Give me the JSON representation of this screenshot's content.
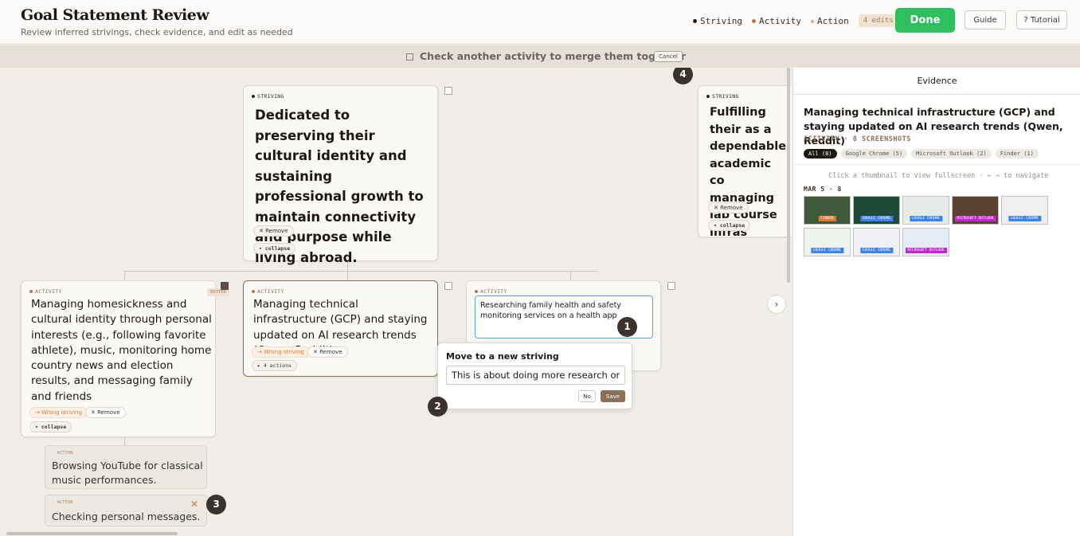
{
  "header": {
    "title": "Goal Statement Review",
    "subtitle": "Review inferred strivings, check evidence, and edit as needed",
    "legend": {
      "striving": "Striving",
      "activity": "Activity",
      "action": "Action"
    },
    "edits_badge": "4 edits",
    "done_label": "Done",
    "guide_label": "Guide",
    "tutorial_label": "? Tutorial"
  },
  "merge_banner": {
    "text": "Check another activity to merge them together",
    "cancel_label": "Cancel"
  },
  "strivings": [
    {
      "tag": "STRIVING",
      "text": "Dedicated to preserving their cultural identity and sustaining professional growth to maintain connectivity and purpose while living abroad.",
      "remove_label": "✕ Remove",
      "collapse_label": "▾ collapse"
    },
    {
      "tag": "STRIVING",
      "text": "Fulfilling their as a dependable academic co managing lab course infras",
      "remove_label": "✕ Remove",
      "collapse_label": "▾ collapse"
    }
  ],
  "activities": [
    {
      "tag": "ACTIVITY",
      "badge": "EDITED",
      "text": "Managing homesickness and cultural identity through personal interests (e.g., following favorite athlete), music, monitoring home country news and election results, and messaging family and friends",
      "wrong_label": "→ Wrong striving",
      "remove_label": "✕ Remove",
      "collapse_label": "▾ collapse"
    },
    {
      "tag": "ACTIVITY",
      "text": "Managing technical infrastructure (GCP) and staying updated on AI research trends (Qwen, Reddit)",
      "wrong_label": "→ Wrong striving",
      "remove_label": "✕ Remove",
      "actions_label": "▸ 4 actions"
    },
    {
      "tag": "ACTIVITY",
      "edit_value": "Researching family health and safety monitoring services on a health app"
    }
  ],
  "actions": [
    {
      "tag": "ACTION",
      "text": "Browsing YouTube for classical music performances."
    },
    {
      "tag": "ACTION",
      "text": "Checking personal messages."
    }
  ],
  "move_popup": {
    "title": "Move to a new striving",
    "input_value": "This is about doing more research oriented",
    "no_label": "No",
    "save_label": "Save"
  },
  "callouts": [
    "1",
    "2",
    "3",
    "4"
  ],
  "evidence": {
    "header": "Evidence",
    "title": "Managing technical infrastructure (GCP) and staying updated on AI research trends (Qwen, Reddit)",
    "meta": "ACTIVITY · 8 SCREENSHOTS",
    "filters": [
      "All (8)",
      "Google Chrome (5)",
      "Microsoft Outlook (2)",
      "Finder (1)"
    ],
    "hint": "Click a thumbnail to view fullscreen · ← → to navigate",
    "date": "MAR 5 · 8",
    "thumbnails": [
      {
        "label": "FINDER",
        "color": "#e07a2f",
        "bg": "#3f5a3a"
      },
      {
        "label": "GOOGLE CHROME",
        "color": "#3b82f6",
        "bg": "#1f4a36"
      },
      {
        "label": "GOOGLE CHROME",
        "color": "#3b82f6",
        "bg": "#e6ede8"
      },
      {
        "label": "MICROSOFT OUTLOOK",
        "color": "#c026d3",
        "bg": "#5a4230"
      },
      {
        "label": "GOOGLE CHROME",
        "color": "#3b82f6",
        "bg": "#f2f0ee"
      },
      {
        "label": "GOOGLE CHROME",
        "color": "#3b82f6",
        "bg": "#eef3ee"
      },
      {
        "label": "GOOGLE CHROME",
        "color": "#3b82f6",
        "bg": "#eef0f5"
      },
      {
        "label": "MICROSOFT OUTLOOK",
        "color": "#c026d3",
        "bg": "#e4ecf6"
      }
    ]
  }
}
